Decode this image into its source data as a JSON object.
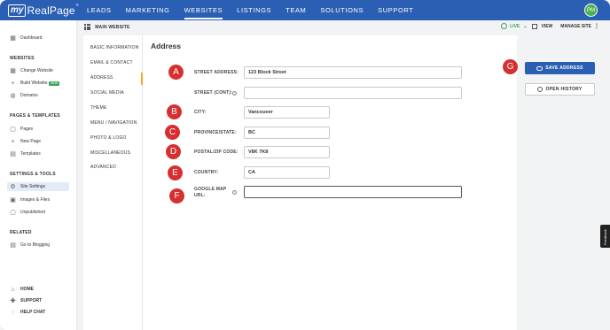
{
  "topnav": {
    "logo_my": "my",
    "logo_rest": "RealPage",
    "logo_tm": "®",
    "items": [
      {
        "label": "LEADS",
        "active": false
      },
      {
        "label": "MARKETING",
        "active": false
      },
      {
        "label": "WEBSITES",
        "active": true
      },
      {
        "label": "LISTINGS",
        "active": false
      },
      {
        "label": "TEAM",
        "active": false
      },
      {
        "label": "SOLUTIONS",
        "active": false
      },
      {
        "label": "SUPPORT",
        "active": false
      }
    ],
    "avatar_initials": "PM"
  },
  "sidebar": {
    "dashboard": "Dashboard",
    "websites_head": "WEBSITES",
    "change_website": "Change Website",
    "build_website": "Build Website",
    "new_badge": "NEW",
    "domains": "Domains",
    "pages_head": "PAGES & TEMPLATES",
    "pages": "Pages",
    "new_page": "New Page",
    "templates": "Templates",
    "settings_head": "SETTINGS & TOOLS",
    "site_settings": "Site Settings",
    "images_files": "Images & Files",
    "unpublished": "Unpublished",
    "related_head": "RELATED",
    "go_to_blogging": "Go to Blogging",
    "home": "HOME",
    "support": "SUPPORT",
    "help_chat": "HELP CHAT"
  },
  "subheader": {
    "site_name": "MAIN WEBSITE",
    "live": "LIVE",
    "view": "VIEW",
    "manage_site": "MANAGE SITE"
  },
  "settings_menu": {
    "items": [
      "BASIC INFORMATION",
      "EMAIL & CONTACT",
      "ADDRESS",
      "SOCIAL MEDIA",
      "THEME",
      "MENU / NAVIGATION",
      "PHOTO & LOGO",
      "MISCELLANEOUS",
      "ADVANCED"
    ],
    "active": "ADDRESS"
  },
  "main": {
    "title": "Address",
    "fields": {
      "street_address": {
        "label": "STREET ADDRESS:",
        "value": "123 Block Street"
      },
      "street_cont": {
        "label": "STREET (CONT):",
        "value": ""
      },
      "city": {
        "label": "CITY:",
        "value": "Vancouver"
      },
      "province": {
        "label": "PROVINCE/STATE:",
        "value": "BC"
      },
      "postal": {
        "label": "POSTAL/ZIP CODE:",
        "value": "V8K 7K8"
      },
      "country": {
        "label": "COUNTRY:",
        "value": "CA"
      },
      "google_map": {
        "label_line1": "GOOGLE MAP",
        "label_line2": "URL:",
        "value": ""
      }
    },
    "help_glyph": "?"
  },
  "actions": {
    "save": "SAVE ADDRESS",
    "history": "OPEN HISTORY"
  },
  "markers": [
    "A",
    "B",
    "C",
    "D",
    "E",
    "F",
    "G"
  ],
  "feedback": "Feedback",
  "colors": {
    "brand_blue": "#2a5fb3",
    "marker_red": "#d62f2f",
    "live_green": "#3aa35b",
    "active_tab": "#f5a623"
  }
}
